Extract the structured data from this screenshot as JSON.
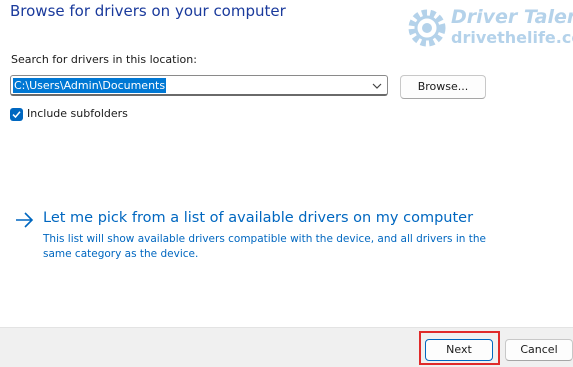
{
  "header": {
    "title": "Browse for drivers on your computer"
  },
  "watermark": {
    "brand": "Driver Talent",
    "url": "drivethelife.com"
  },
  "search": {
    "label": "Search for drivers in this location:",
    "path_value": "C:\\Users\\Admin\\Documents",
    "browse_label": "Browse..."
  },
  "options": {
    "include_subfolders_label": "Include subfolders",
    "include_subfolders_checked": true
  },
  "pick_link": {
    "title": "Let me pick from a list of available drivers on my computer",
    "description": "This list will show available drivers compatible with the device, and all drivers in the same category as the device."
  },
  "footer": {
    "next_label": "Next",
    "cancel_label": "Cancel"
  },
  "icons": [
    "chevron-down-icon",
    "checkmark-icon",
    "right-arrow-icon",
    "gear-logo-icon"
  ],
  "colors": {
    "title": "#1a3a9c",
    "accent": "#0067c0",
    "selection": "#0078d4",
    "highlight": "#e02a2a",
    "footer_bg": "#f0f0f0",
    "watermark": "#b4d2ea"
  }
}
